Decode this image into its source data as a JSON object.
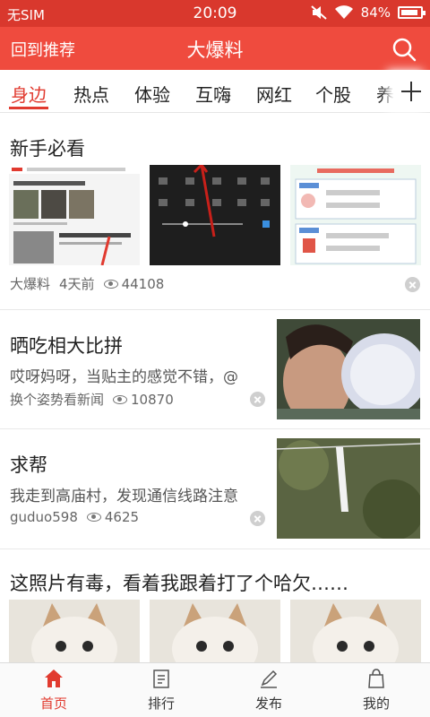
{
  "status_bar": {
    "carrier": "无SIM",
    "time": "20:09",
    "battery": "84%",
    "icons": [
      "mute-icon",
      "wifi-icon",
      "battery-icon"
    ]
  },
  "header": {
    "back_label": "回到推荐",
    "title": "大爆料",
    "search_icon": "search-icon",
    "bg_color": "#ef4b3e"
  },
  "tabs": {
    "items": [
      "身边",
      "热点",
      "体验",
      "互嗨",
      "网红",
      "个股",
      "养"
    ],
    "active_index": 0,
    "add_icon": "plus-icon",
    "accent_color": "#e13a2f"
  },
  "feed": [
    {
      "title": "新手必看",
      "source": "大爆料",
      "time": "4天前",
      "views": "44108",
      "images": [
        "screenshot-news-app",
        "screenshot-settings",
        "screenshot-red-packet"
      ]
    },
    {
      "title": "晒吃相大比拼",
      "snippet": "哎呀妈呀，当贴主的感觉不错，@",
      "source": "换个姿势看新闻",
      "views": "10870",
      "image": "woman-drinking-from-bowl"
    },
    {
      "title": "求帮",
      "snippet": "我走到高庙村，发现通信线路注意",
      "source": "guduo598",
      "views": "4625",
      "image": "hanging-sign-on-wire"
    },
    {
      "title": "这照片有毒，看着我跟着打了个哈欠……",
      "images": [
        "yawning-cat",
        "yawning-cat",
        "yawning-cat"
      ]
    }
  ],
  "bottom_nav": {
    "items": [
      {
        "label": "首页",
        "icon": "home-icon"
      },
      {
        "label": "排行",
        "icon": "ranking-icon"
      },
      {
        "label": "发布",
        "icon": "pencil-icon"
      },
      {
        "label": "我的",
        "icon": "bag-icon"
      }
    ],
    "active_index": 0
  }
}
